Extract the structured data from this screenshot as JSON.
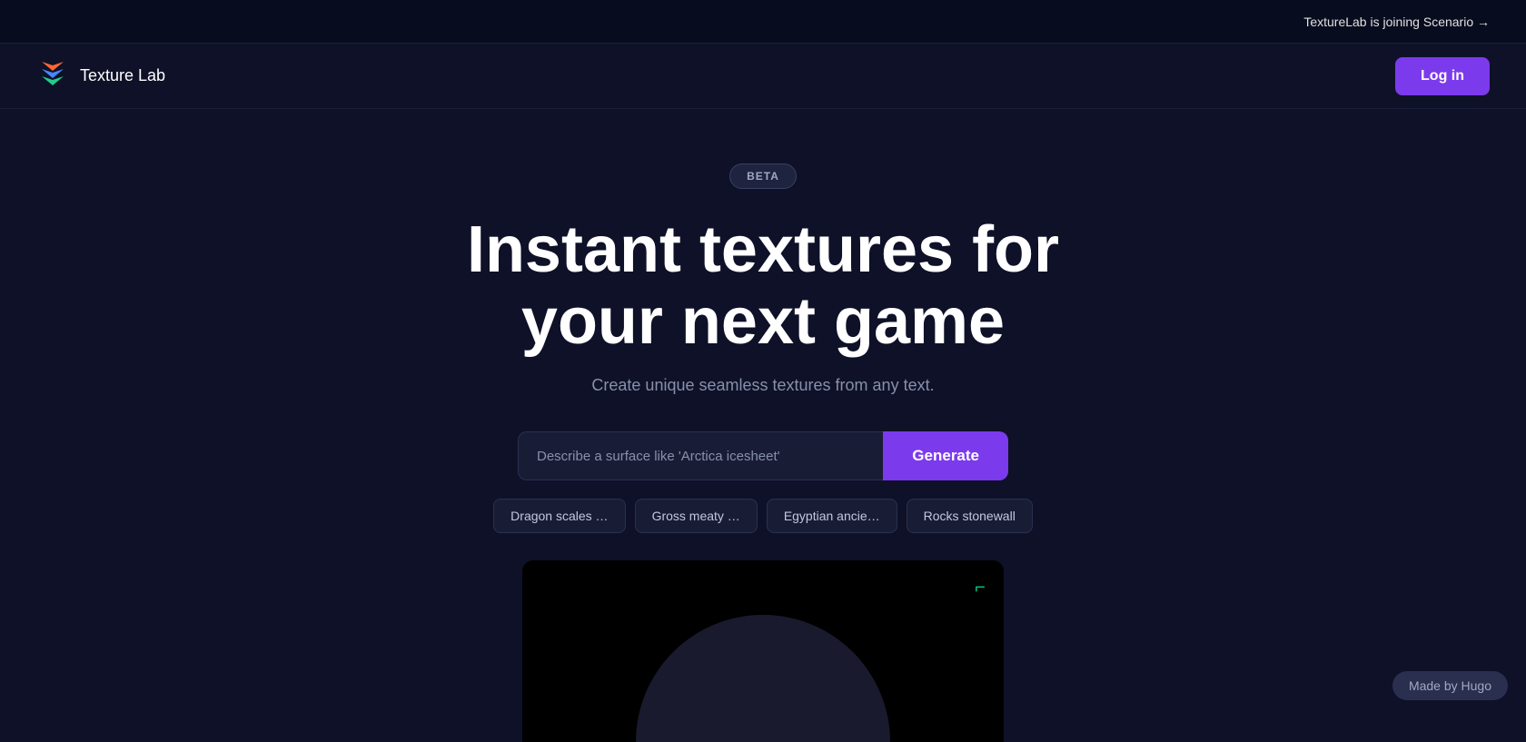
{
  "announcement": {
    "text": "TextureLab is joining Scenario →",
    "arrow": "→"
  },
  "nav": {
    "logo_text": "Texture Lab",
    "login_label": "Log in"
  },
  "hero": {
    "beta_label": "BETA",
    "title_line1": "Instant textures for",
    "title_line2": "your next game",
    "subtitle": "Create unique seamless textures from any text.",
    "input_placeholder": "Describe a surface like 'Arctica icesheet'",
    "generate_label": "Generate"
  },
  "suggestions": [
    {
      "label": "Dragon scales …"
    },
    {
      "label": "Gross meaty …"
    },
    {
      "label": "Egyptian ancie…"
    },
    {
      "label": "Rocks stonewall"
    }
  ],
  "footer": {
    "made_by": "Made by Hugo"
  },
  "colors": {
    "accent_purple": "#7c3aed",
    "bg_dark": "#0e1128",
    "bg_darker": "#080c1f"
  }
}
